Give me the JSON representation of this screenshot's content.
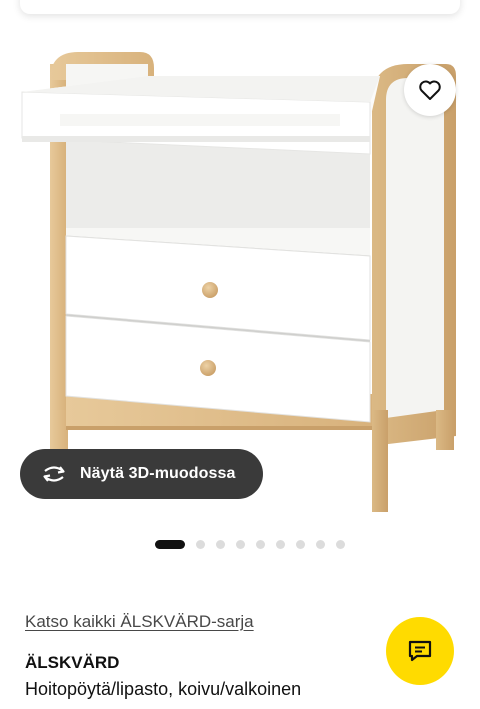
{
  "product": {
    "series_link": "Katso kaikki ÄLSKVÄRD-sarja",
    "name": "ÄLSKVÄRD",
    "description": "Hoitopöytä/lipasto, koivu/valkoinen"
  },
  "gallery": {
    "view_3d_label": "Näytä 3D-muodossa",
    "image_count": 9,
    "active_index": 0
  },
  "icons": {
    "favourite": "heart-icon",
    "view_3d": "rotate-3d-icon",
    "chat": "chat-bubble-icon"
  },
  "colors": {
    "accent": "#ffdb00",
    "dark_button": "#3a3a3a",
    "active_dot": "#111111",
    "inactive_dot": "#dcdcdc"
  }
}
